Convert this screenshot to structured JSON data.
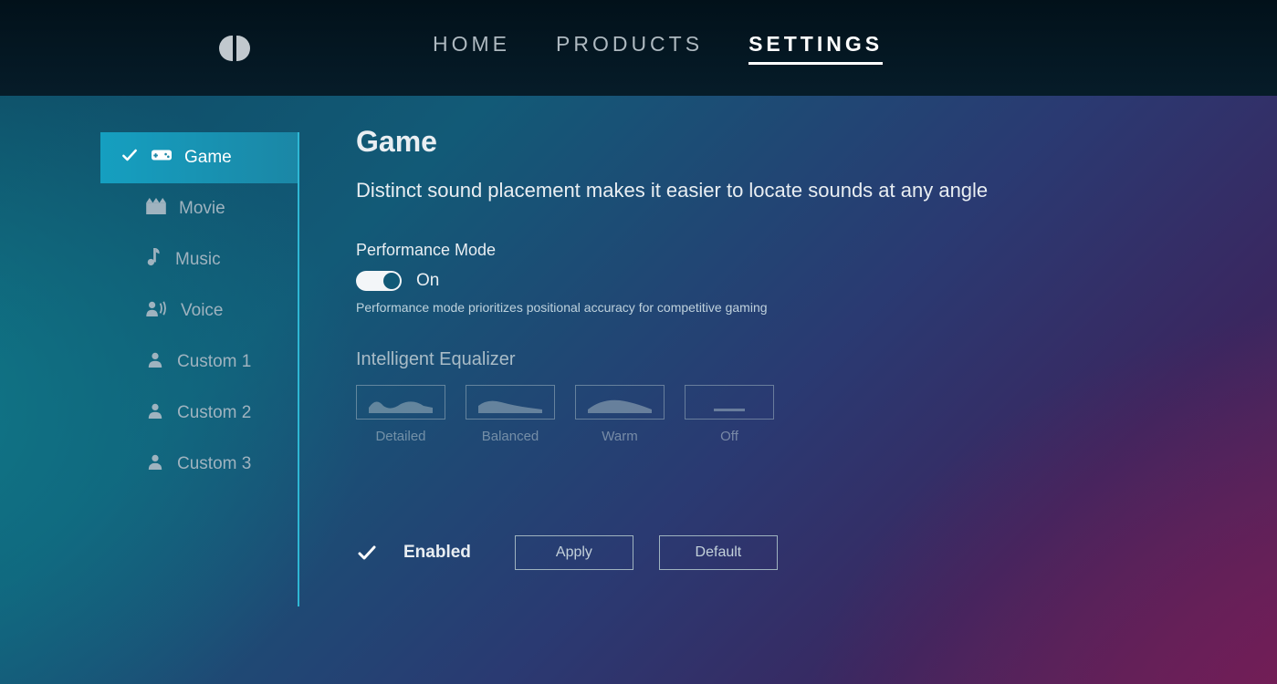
{
  "nav": {
    "items": [
      {
        "label": "HOME"
      },
      {
        "label": "PRODUCTS"
      },
      {
        "label": "SETTINGS"
      }
    ]
  },
  "sidebar": {
    "items": [
      {
        "label": "Game"
      },
      {
        "label": "Movie"
      },
      {
        "label": "Music"
      },
      {
        "label": "Voice"
      },
      {
        "label": "Custom 1"
      },
      {
        "label": "Custom 2"
      },
      {
        "label": "Custom 3"
      }
    ]
  },
  "main": {
    "title": "Game",
    "description": "Distinct sound placement makes it easier to locate sounds at any angle",
    "perf_label": "Performance Mode",
    "perf_state": "On",
    "perf_hint": "Performance mode prioritizes positional accuracy for competitive gaming",
    "eq_label": "Intelligent Equalizer",
    "eq_options": [
      {
        "label": "Detailed"
      },
      {
        "label": "Balanced"
      },
      {
        "label": "Warm"
      },
      {
        "label": "Off"
      }
    ],
    "enabled_label": "Enabled",
    "apply_label": "Apply",
    "default_label": "Default"
  }
}
